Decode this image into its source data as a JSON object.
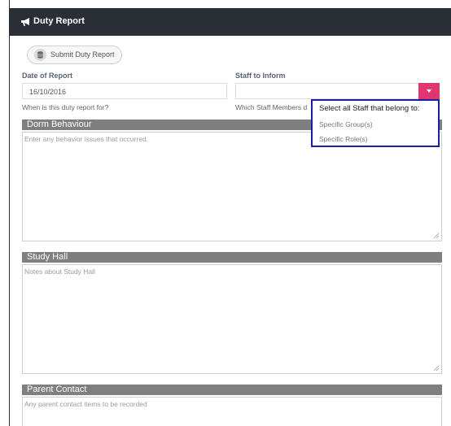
{
  "header": {
    "title": "Duty Report",
    "icon": "megaphone-icon"
  },
  "toolbar": {
    "submit_label": "Submit Duty Report",
    "submit_icon": "database-icon"
  },
  "form": {
    "date": {
      "label": "Date of Report",
      "value": "16/10/2016",
      "help": "When is this duty report for?"
    },
    "staff": {
      "label": "Staff to Inform",
      "value": "",
      "help": "Which Staff Members d"
    }
  },
  "staff_dropdown": {
    "title": "Select all Staff that belong to:",
    "options": [
      "Specific Group(s)",
      "Specific Role(s)"
    ]
  },
  "sections": {
    "dorm": {
      "title": "Dorm Behaviour",
      "placeholder": "Enter any behavior issues that occurred."
    },
    "study": {
      "title": "Study Hall",
      "placeholder": "Notes about Study Hall"
    },
    "parent": {
      "title": "Parent Contact",
      "placeholder": "Any parent contact items to be recorded"
    }
  },
  "colors": {
    "header_bg": "#2a2f36",
    "accent": "#e0356f",
    "dropdown_border": "#1a1fa3",
    "section_bar": "#7f7f7f"
  }
}
